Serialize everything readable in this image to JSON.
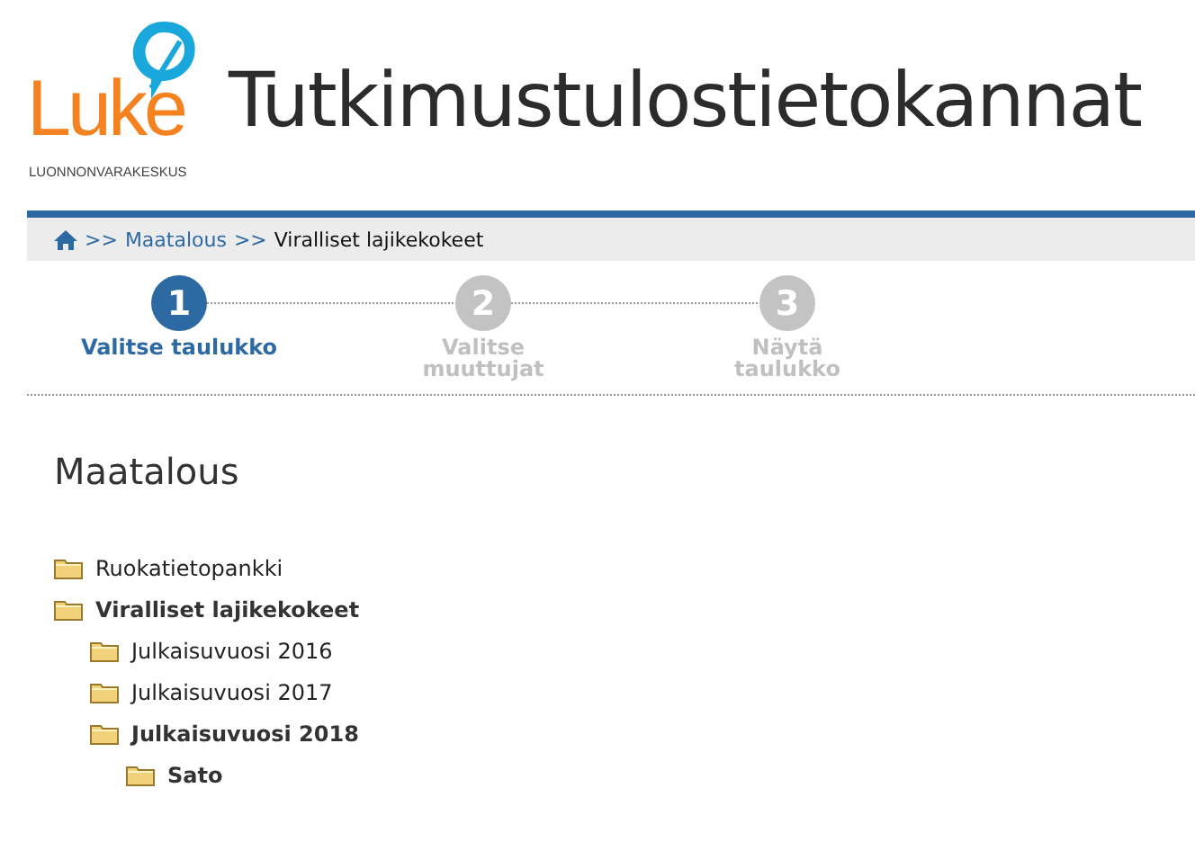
{
  "logo": {
    "name": "Luke",
    "subtitle": "LUONNONVARAKESKUS"
  },
  "title": "Tutkimustulostietokannat",
  "breadcrumb": {
    "separator": ">>",
    "links": [
      "Maatalous"
    ],
    "current": "Viralliset lajikekokeet"
  },
  "steps": [
    {
      "number": "1",
      "label": "Valitse taulukko",
      "selected": true
    },
    {
      "number": "2",
      "label": "Valitse muuttujat",
      "selected": false
    },
    {
      "number": "3",
      "label": "Näytä taulukko",
      "selected": false
    }
  ],
  "heading": "Maatalous",
  "tree": [
    {
      "label": "Ruokatietopankki",
      "expanded": false
    },
    {
      "label": "Viralliset lajikekokeet",
      "expanded": true,
      "children": [
        {
          "label": "Julkaisuvuosi 2016",
          "expanded": false
        },
        {
          "label": "Julkaisuvuosi 2017",
          "expanded": false
        },
        {
          "label": "Julkaisuvuosi 2018",
          "expanded": true,
          "children": [
            {
              "label": "Sato",
              "expanded": true
            }
          ]
        }
      ]
    }
  ]
}
